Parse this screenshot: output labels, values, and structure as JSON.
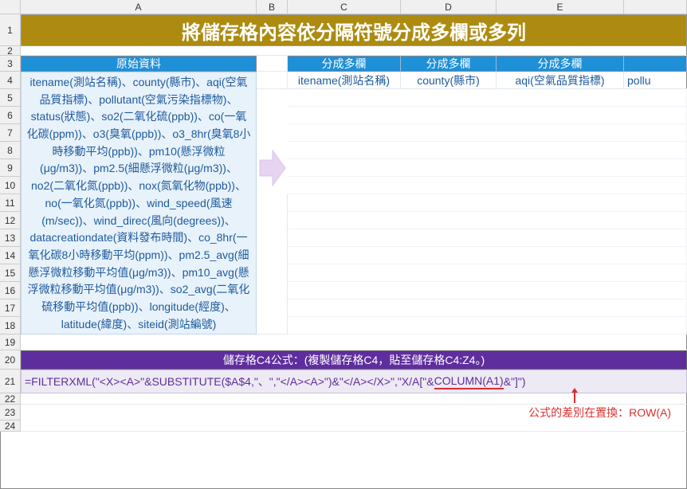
{
  "columns": [
    "A",
    "B",
    "C",
    "D",
    "E"
  ],
  "rows": [
    "1",
    "2",
    "3",
    "4",
    "5",
    "6",
    "7",
    "8",
    "9",
    "10",
    "11",
    "12",
    "13",
    "14",
    "15",
    "16",
    "17",
    "18",
    "19",
    "20",
    "21",
    "22",
    "23",
    "24"
  ],
  "title": "將儲存格內容依分隔符號分成多欄或多列",
  "headers": {
    "original": "原始資料",
    "multi_c": "分成多欄",
    "multi_d": "分成多欄",
    "multi_e": "分成多欄"
  },
  "original_data": "itename(測站名稱)、county(縣市)、aqi(空氣品質指標)、pollutant(空氣污染指標物)、status(狀態)、so2(二氧化硫(ppb))、co(一氧化碳(ppm))、o3(臭氧(ppb))、o3_8hr(臭氧8小時移動平均(ppb))、pm10(懸浮微粒(μg/m3))、pm2.5(細懸浮微粒(μg/m3))、no2(二氧化氮(ppb))、nox(氮氧化物(ppb))、no(一氧化氮(ppb))、wind_speed(風速(m/sec))、wind_direc(風向(degrees))、datacreationdate(資料發布時間)、co_8hr(一氧化碳8小時移動平均(ppm))、pm2.5_avg(細懸浮微粒移動平均值(μg/m3))、pm10_avg(懸浮微粒移動平均值(μg/m3))、so2_avg(二氧化硫移動平均值(ppb))、longitude(經度)、latitude(緯度)、siteid(測站編號)",
  "results": {
    "c4": "itename(測站名稱)",
    "d4": "county(縣市)",
    "e4": "aqi(空氣品質指標)",
    "f4": "pollu"
  },
  "formula_header": "儲存格C4公式：(複製儲存格C4，貼至儲存格C4:Z4。)",
  "formula_pre": "=FILTERXML(\"<X><A>\"&SUBSTITUTE($A$4,\"、\",\"</A><A>\")&\"</A></X>\",\"X/A[\"&",
  "formula_highlight": "COLUMN(A1)",
  "formula_post": "&\"]\")",
  "note": "公式的差別在置換：ROW(A)"
}
